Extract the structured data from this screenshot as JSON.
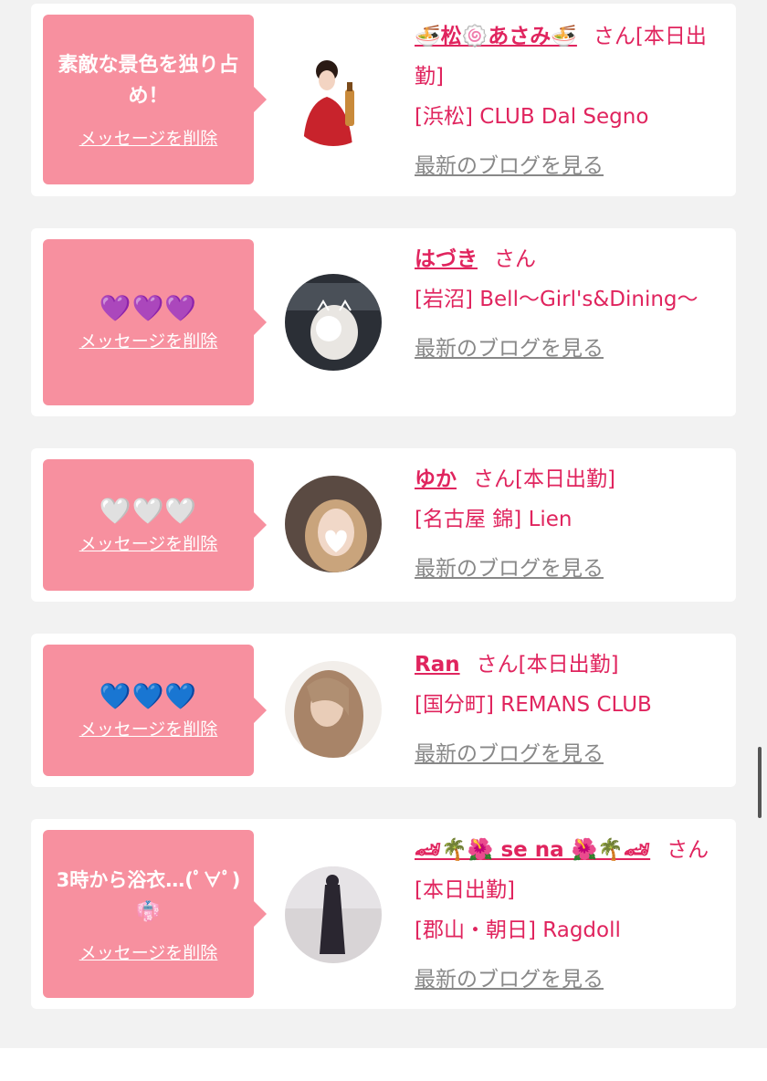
{
  "cards": [
    {
      "message": "素敵な景色を独り占め！",
      "delete_label": "メッセージを削除",
      "name": "🍜松🍥あさみ🍜",
      "san": "さん[本日出勤]",
      "shop": "[浜松] CLUB Dal Segno",
      "blog_label": "最新のブログを見る"
    },
    {
      "message": "💜💜💜",
      "delete_label": "メッセージを削除",
      "name": "はづき",
      "san": "さん",
      "shop": "[岩沼] Bell〜Girl's&Dining〜",
      "blog_label": "最新のブログを見る"
    },
    {
      "message": "🤍🤍🤍",
      "delete_label": "メッセージを削除",
      "name": "ゆか",
      "san": "さん[本日出勤]",
      "shop": "[名古屋 錦] Lien",
      "blog_label": "最新のブログを見る"
    },
    {
      "message": "💙💙💙",
      "delete_label": "メッセージを削除",
      "name": "Ran",
      "san": "さん[本日出勤]",
      "shop": "[国分町] REMANS CLUB",
      "blog_label": "最新のブログを見る"
    },
    {
      "message": "3時から浴衣…(ﾟ∀ﾟ)👘",
      "delete_label": "メッセージを削除",
      "name": "🏎🌴🌺 se na 🌺🌴🏎",
      "san": "さん[本日出勤]",
      "shop": "[郡山・朝日] Ragdoll",
      "blog_label": "最新のブログを見る"
    }
  ]
}
